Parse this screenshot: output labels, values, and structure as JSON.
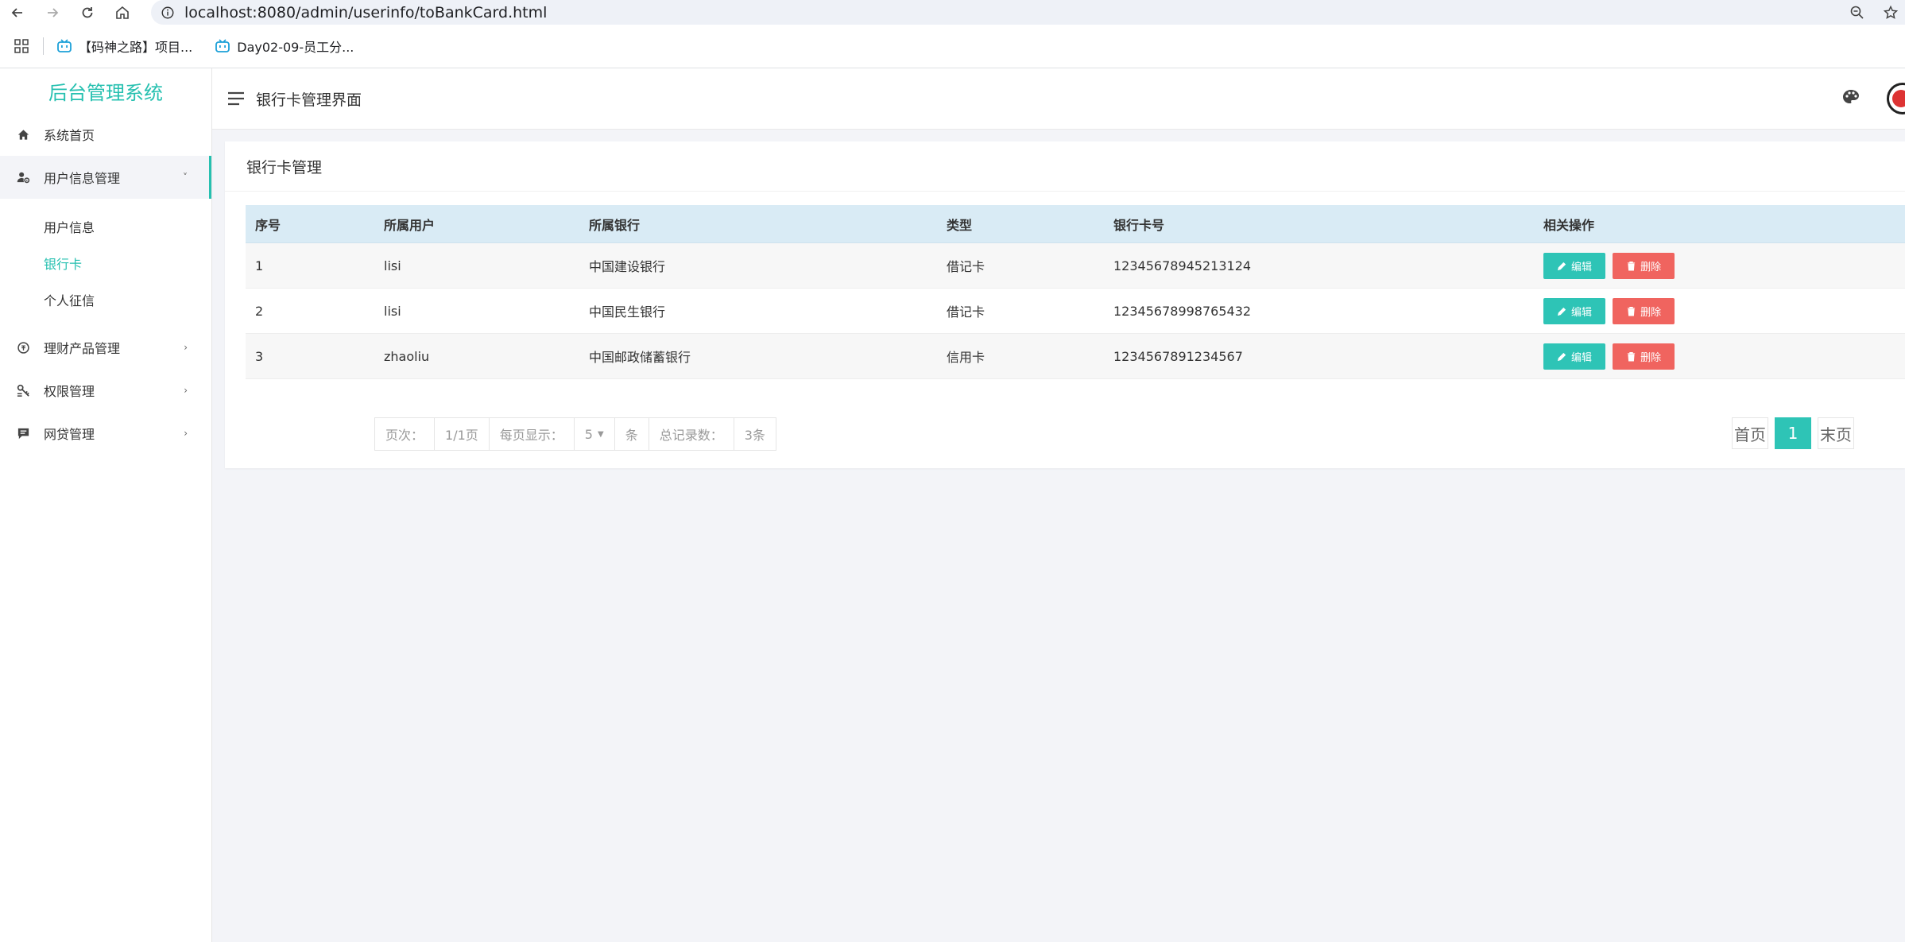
{
  "browser": {
    "url": "localhost:8080/admin/userinfo/toBankCard.html",
    "bookmarks": [
      {
        "label": "【码神之路】项目..."
      },
      {
        "label": "Day02-09-员工分..."
      }
    ]
  },
  "sidebar": {
    "logo": "后台管理系统",
    "menu": [
      {
        "label": "系统首页"
      },
      {
        "label": "用户信息管理",
        "arrow": "˅"
      },
      {
        "label": "理财产品管理",
        "arrow": "›"
      },
      {
        "label": "权限管理",
        "arrow": "›"
      },
      {
        "label": "网贷管理",
        "arrow": "›"
      }
    ],
    "submenu": [
      {
        "label": "用户信息"
      },
      {
        "label": "银行卡"
      },
      {
        "label": "个人征信"
      }
    ]
  },
  "header": {
    "title": "银行卡管理界面"
  },
  "card": {
    "title": "银行卡管理",
    "columns": [
      "序号",
      "所属用户",
      "所属银行",
      "类型",
      "银行卡号",
      "相关操作"
    ],
    "rows": [
      {
        "no": "1",
        "user": "lisi",
        "bank": "中国建设银行",
        "type": "借记卡",
        "card": "12345678945213124"
      },
      {
        "no": "2",
        "user": "lisi",
        "bank": "中国民生银行",
        "type": "借记卡",
        "card": "12345678998765432"
      },
      {
        "no": "3",
        "user": "zhaoliu",
        "bank": "中国邮政储蓄银行",
        "type": "信用卡",
        "card": "1234567891234567"
      }
    ],
    "edit_label": "编辑",
    "delete_label": "删除"
  },
  "pagination": {
    "page_label": "页次：",
    "page_value": "1/1页",
    "per_page_label": "每页显示：",
    "per_page_value": "5",
    "unit": "条",
    "total_label": "总记录数：",
    "total_value": "3条",
    "first": "首页",
    "current": "1",
    "last": "末页"
  },
  "colors": {
    "accent": "#2ec4b6",
    "danger": "#f0645f",
    "table_header": "#d9ebf5"
  }
}
